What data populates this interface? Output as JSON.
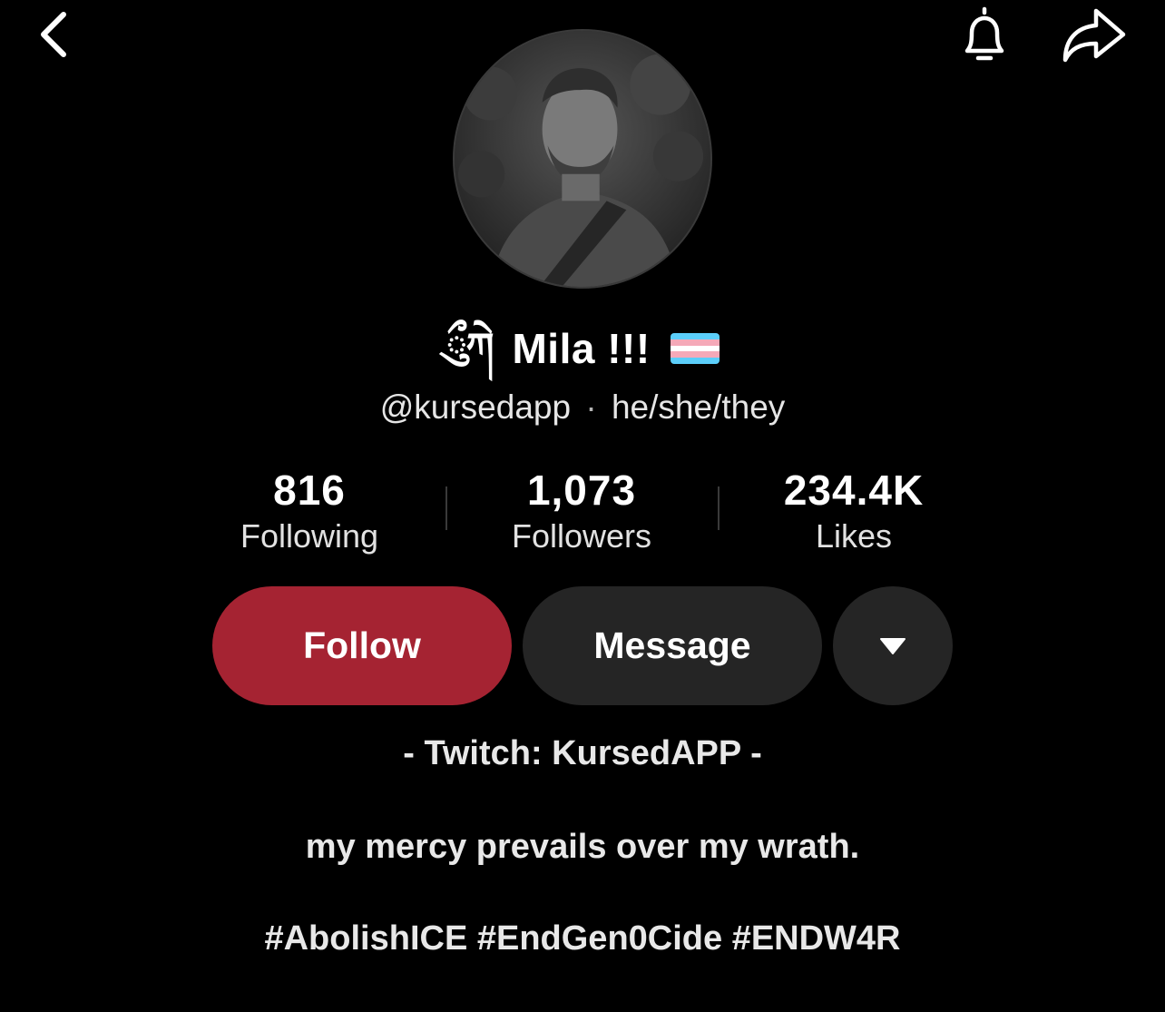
{
  "topbar": {
    "back_icon": "chevron-left-icon",
    "bell_icon": "bell-icon",
    "share_icon": "share-arrow-icon"
  },
  "profile": {
    "avatar_icon": "profile-photo",
    "name_prefix_glyph": "ྀུཀེ",
    "display_name": "Mila !!!",
    "flag_icon": "transgender-flag-icon",
    "flag_colors": [
      "#5BCEFA",
      "#F5A9B8",
      "#FFFFFF",
      "#F5A9B8",
      "#5BCEFA"
    ],
    "handle": "@kursedapp",
    "separator": "·",
    "pronouns": "he/she/they"
  },
  "stats": [
    {
      "value": "816",
      "label": "Following"
    },
    {
      "value": "1,073",
      "label": "Followers"
    },
    {
      "value": "234.4K",
      "label": "Likes"
    }
  ],
  "actions": {
    "follow_label": "Follow",
    "message_label": "Message",
    "more_icon": "caret-down-icon",
    "follow_color": "#A52332",
    "secondary_color": "#252525"
  },
  "bio": {
    "line1": "- Twitch: KursedAPP -",
    "line2": "my mercy prevails over my wrath.",
    "line3": "#AbolishICE #EndGen0Cide #ENDW4R"
  }
}
